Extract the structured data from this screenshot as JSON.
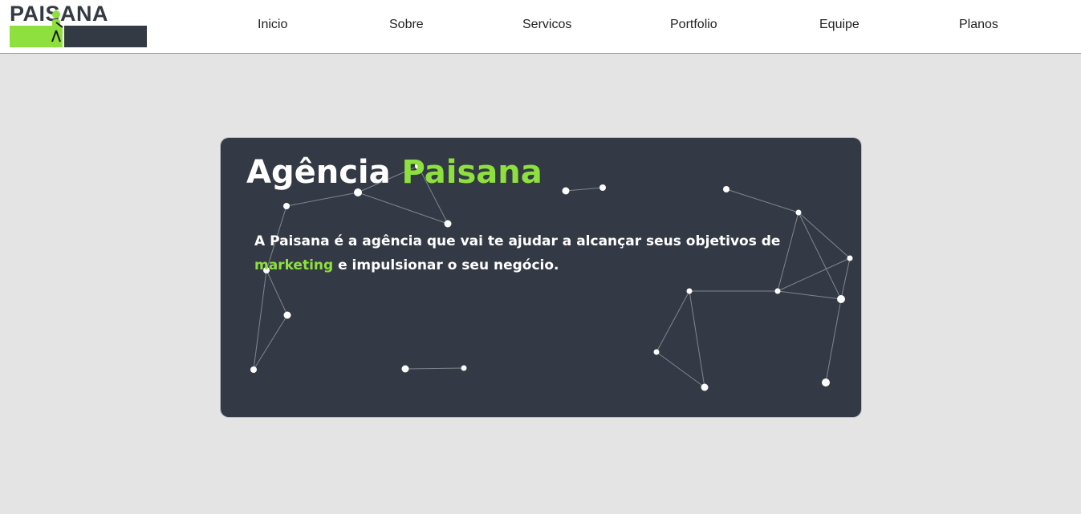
{
  "logo": {
    "text": "PAISANA",
    "alt": "Paisana logo"
  },
  "nav": {
    "items": [
      {
        "label": "Inicio"
      },
      {
        "label": "Sobre"
      },
      {
        "label": "Servicos"
      },
      {
        "label": "Portfolio"
      },
      {
        "label": "Equipe"
      },
      {
        "label": "Planos"
      }
    ]
  },
  "hero": {
    "title_part1": "Agência",
    "title_part2": "Paisana",
    "desc_part1": "A Paisana é a agência que vai te ajudar a alcançar seus objetivos de",
    "desc_highlight": "marketing",
    "desc_part2": "e impulsionar o seu negócio."
  },
  "colors": {
    "accent": "#8ee03e",
    "card_bg": "#343a45",
    "page_bg": "#e4e4e4",
    "text_light": "#ffffff"
  }
}
